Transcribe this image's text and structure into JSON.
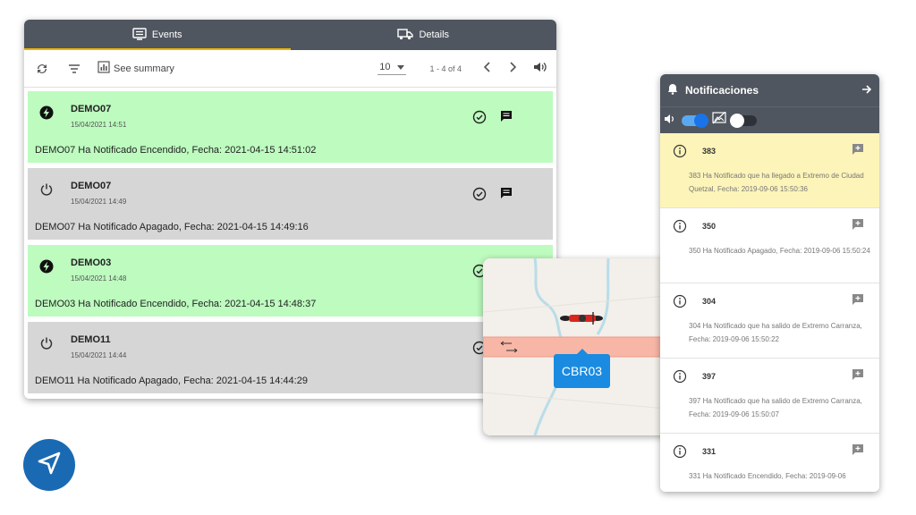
{
  "events_panel": {
    "tabs": [
      {
        "label": "Events",
        "icon": "list-icon",
        "active": true
      },
      {
        "label": "Details",
        "icon": "truck-icon",
        "active": false
      }
    ],
    "toolbar": {
      "summary_label": "See summary",
      "page_size": "10",
      "range": "1 - 4 of 4"
    },
    "accent_color": "#f1b400",
    "events": [
      {
        "device": "DEMO07",
        "time": "15/04/2021 14:51",
        "message": "DEMO07 Ha Notificado Encendido, Fecha: 2021-04-15 14:51:02",
        "status": "on"
      },
      {
        "device": "DEMO07",
        "time": "15/04/2021 14:49",
        "message": "DEMO07 Ha Notificado Apagado, Fecha: 2021-04-15 14:49:16",
        "status": "off"
      },
      {
        "device": "DEMO03",
        "time": "15/04/2021 14:48",
        "message": "DEMO03 Ha Notificado Encendido, Fecha: 2021-04-15 14:48:37",
        "status": "on"
      },
      {
        "device": "DEMO11",
        "time": "15/04/2021 14:44",
        "message": "DEMO11 Ha Notificado Apagado, Fecha: 2021-04-15 14:44:29",
        "status": "off"
      }
    ],
    "colors": {
      "on": "#bdfbbf",
      "off": "#d6d6d6"
    }
  },
  "map": {
    "vehicle_label": "CBR03",
    "label_color": "#1a8be0"
  },
  "notifications": {
    "title": "Notificaciones",
    "items": [
      {
        "id": "383",
        "message": "383 Ha Notificado que ha llegado a Extremo de Ciudad Quetzal, Fecha: 2019-09-06 15:50:36",
        "highlight": true
      },
      {
        "id": "350",
        "message": "350 Ha Notificado Apagado, Fecha: 2019-09-06 15:50:24",
        "highlight": false
      },
      {
        "id": "304",
        "message": "304 Ha Notificado que ha salido de Extremo Carranza, Fecha: 2019-09-06 15:50:22",
        "highlight": false
      },
      {
        "id": "397",
        "message": "397 Ha Notificado que ha salido de Extremo Carranza, Fecha: 2019-09-06 15:50:07",
        "highlight": false
      },
      {
        "id": "331",
        "message": "331 Ha Notificado Encendido, Fecha: 2019-09-06",
        "highlight": false
      }
    ],
    "sound_toggle": true,
    "popup_toggle": false
  },
  "logo": {
    "icon": "navigation-arrow-icon",
    "color": "#1a6ab3"
  }
}
